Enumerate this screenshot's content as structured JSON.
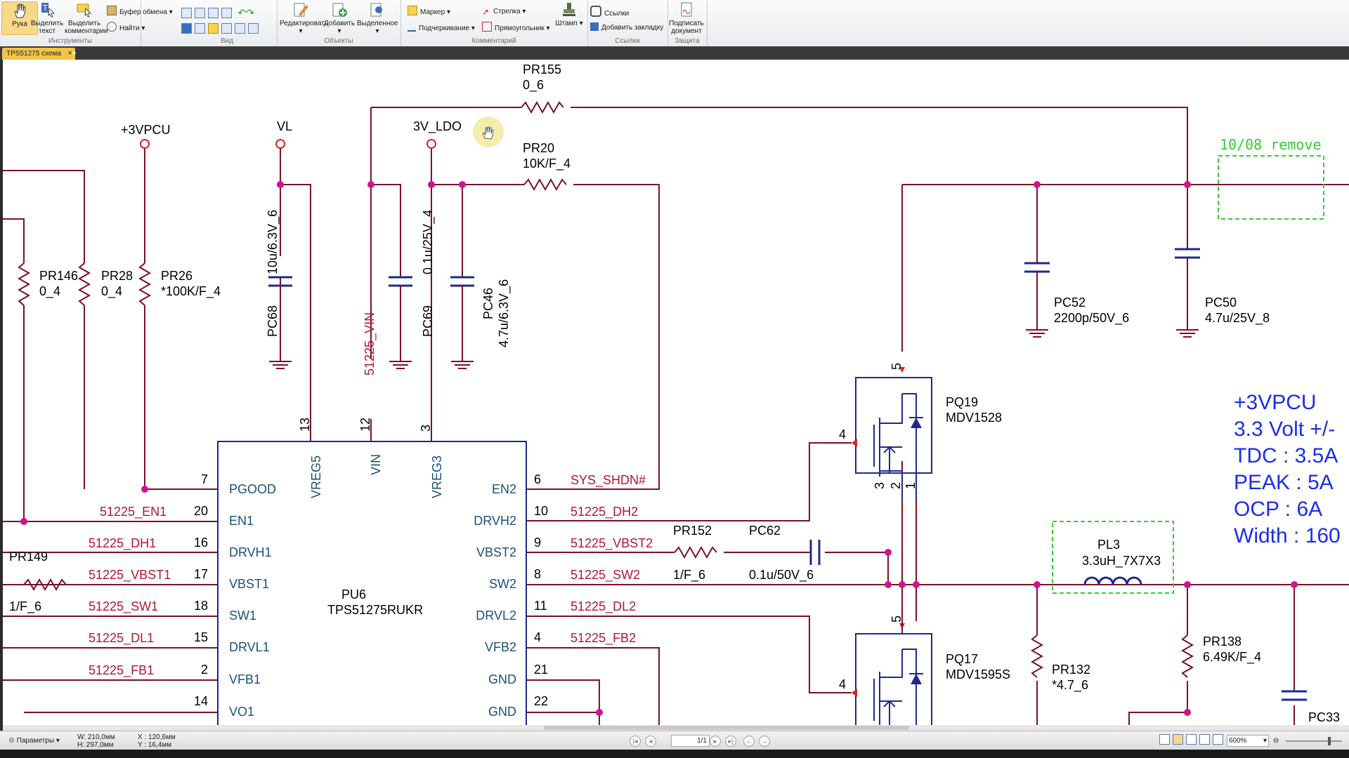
{
  "ribbon": {
    "tools": {
      "hand": "Рука",
      "select_text": "Выделить\nтекст",
      "select_comments": "Выделить\nкомментарии",
      "clipboard": "Буфер обмена",
      "find": "Найти",
      "group": "Инструменты"
    },
    "view": {
      "group": "Вид"
    },
    "objects": {
      "edit": "Редактировать",
      "add": "Добавить",
      "selected": "Выделенное",
      "group": "Объекты"
    },
    "comments": {
      "marker": "Маркер",
      "underline": "Подчеркивание",
      "arrow": "Стрелка",
      "rectangle": "Прямоугольник",
      "stamp": "Штамп",
      "group": "Комментарий"
    },
    "links": {
      "links": "Ссылки",
      "add_bookmark": "Добавить закладку",
      "group": "Ссылки"
    },
    "protect": {
      "sign": "Подписать\nдокумент",
      "group": "Защита"
    }
  },
  "tab": {
    "title": "TPS51275 схема",
    "close": "×",
    "new": "+"
  },
  "status": {
    "params": "Параметры",
    "w": "W: 210,0мм",
    "h": "H: 297,0мм",
    "x": "X : 120,6мм",
    "y": "Y : 16,4мм",
    "page": "1/1",
    "zoom": "600%"
  },
  "schematic": {
    "nets": {
      "v3pcu": "+3VPCU",
      "vl": "VL",
      "ldo": "3V_LDO",
      "vin": "51225_VIN",
      "sys_shdn": "SYS_SHDN#",
      "en1": "51225_EN1",
      "dh1": "51225_DH1",
      "vbst1": "51225_VBST1",
      "sw1": "51225_SW1",
      "dl1": "51225_DL1",
      "fb1": "51225_FB1",
      "dh2": "51225_DH2",
      "vbst2": "51225_VBST2",
      "sw2": "51225_SW2",
      "dl2": "51225_DL2",
      "fb2": "51225_FB2"
    },
    "parts": {
      "pr155": "PR155",
      "pr155v": "0_6",
      "pr20": "PR20",
      "pr20v": "10K/F_4",
      "pr146": "PR146",
      "pr146v": "0_4",
      "pr28": "PR28",
      "pr28v": "0_4",
      "pr26": "PR26",
      "pr26v": "*100K/F_4",
      "pc68": "PC68",
      "pc68v": "10u/6.3V_6",
      "pc69": "PC69",
      "pc69v": "0.1u/25V_4",
      "pc46": "PC46",
      "pc46v": "4.7u/6.3V_6",
      "pc52": "PC52",
      "pc52v": "2200p/50V_6",
      "pc50": "PC50",
      "pc50v": "4.7u/25V_8",
      "pq19": "PQ19",
      "pq19v": "MDV1528",
      "pq17": "PQ17",
      "pq17v": "MDV1595S",
      "pr152": "PR152",
      "pr152v": "1/F_6",
      "pc62": "PC62",
      "pc62v": "0.1u/50V_6",
      "pl3": "PL3",
      "pl3v": "3.3uH_7X7X3",
      "pr138": "PR138",
      "pr138v": "6.49K/F_4",
      "pr132": "PR132",
      "pr132v": "*4.7_6",
      "pr149": "PR149",
      "pr149v": "1/F_6",
      "pc33": "PC33",
      "pu6": "PU6",
      "pu6v": "TPS51275RUKR"
    },
    "pins_left": [
      {
        "name": "PGOOD",
        "num": "7"
      },
      {
        "name": "EN1",
        "num": "20"
      },
      {
        "name": "DRVH1",
        "num": "16"
      },
      {
        "name": "VBST1",
        "num": "17"
      },
      {
        "name": "SW1",
        "num": "18"
      },
      {
        "name": "DRVL1",
        "num": "15"
      },
      {
        "name": "VFB1",
        "num": "2"
      },
      {
        "name": "VO1",
        "num": "14"
      }
    ],
    "pins_right": [
      {
        "name": "EN2",
        "num": "6"
      },
      {
        "name": "DRVH2",
        "num": "10"
      },
      {
        "name": "VBST2",
        "num": "9"
      },
      {
        "name": "SW2",
        "num": "8"
      },
      {
        "name": "DRVL2",
        "num": "11"
      },
      {
        "name": "VFB2",
        "num": "4"
      },
      {
        "name": "GND",
        "num": "21"
      },
      {
        "name": "GND",
        "num": "22"
      }
    ],
    "pins_top": [
      {
        "name": "VREG5",
        "num": "13"
      },
      {
        "name": "VIN",
        "num": "12"
      },
      {
        "name": "VREG3",
        "num": "3"
      }
    ],
    "mos_pins": {
      "gate": "4",
      "drain": "5",
      "s3": "3",
      "s2": "2",
      "s1": "1"
    },
    "remove_note": "10/08 remove",
    "spec": [
      "+3VPCU",
      "3.3 Volt +/-",
      "TDC : 3.5A",
      "PEAK : 5A",
      "OCP : 6A",
      "Width : 160"
    ]
  },
  "colors": {
    "wire": "#7a1126",
    "part": "#1b2a8a",
    "pin_text": "#1d4f7a",
    "net_text": "#b4162e",
    "dot": "#d4118c",
    "highlight": "#f0e68c",
    "note": "#33cc33"
  }
}
